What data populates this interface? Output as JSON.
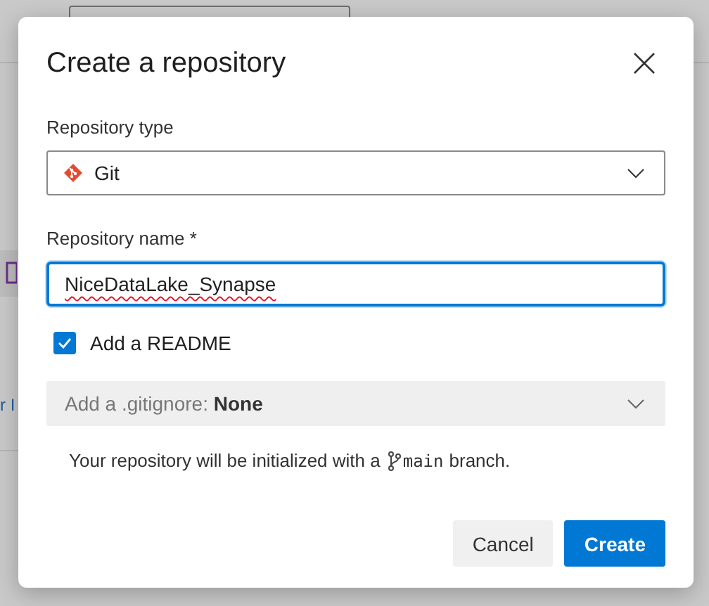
{
  "backdrop": {
    "link_fragment": "r I"
  },
  "dialog": {
    "title": "Create a repository",
    "repository_type": {
      "label": "Repository type",
      "value": "Git"
    },
    "repository_name": {
      "label": "Repository name *",
      "value": "NiceDataLake_Synapse",
      "focused": true
    },
    "add_readme": {
      "label": "Add a README",
      "checked": true
    },
    "gitignore": {
      "label": "Add a .gitignore:",
      "value": "None"
    },
    "info": {
      "before": "Your repository will be initialized with a",
      "branch": "main",
      "after": "branch."
    },
    "buttons": [
      {
        "label": "Cancel",
        "kind": "secondary"
      },
      {
        "label": "Create",
        "kind": "primary"
      }
    ]
  }
}
